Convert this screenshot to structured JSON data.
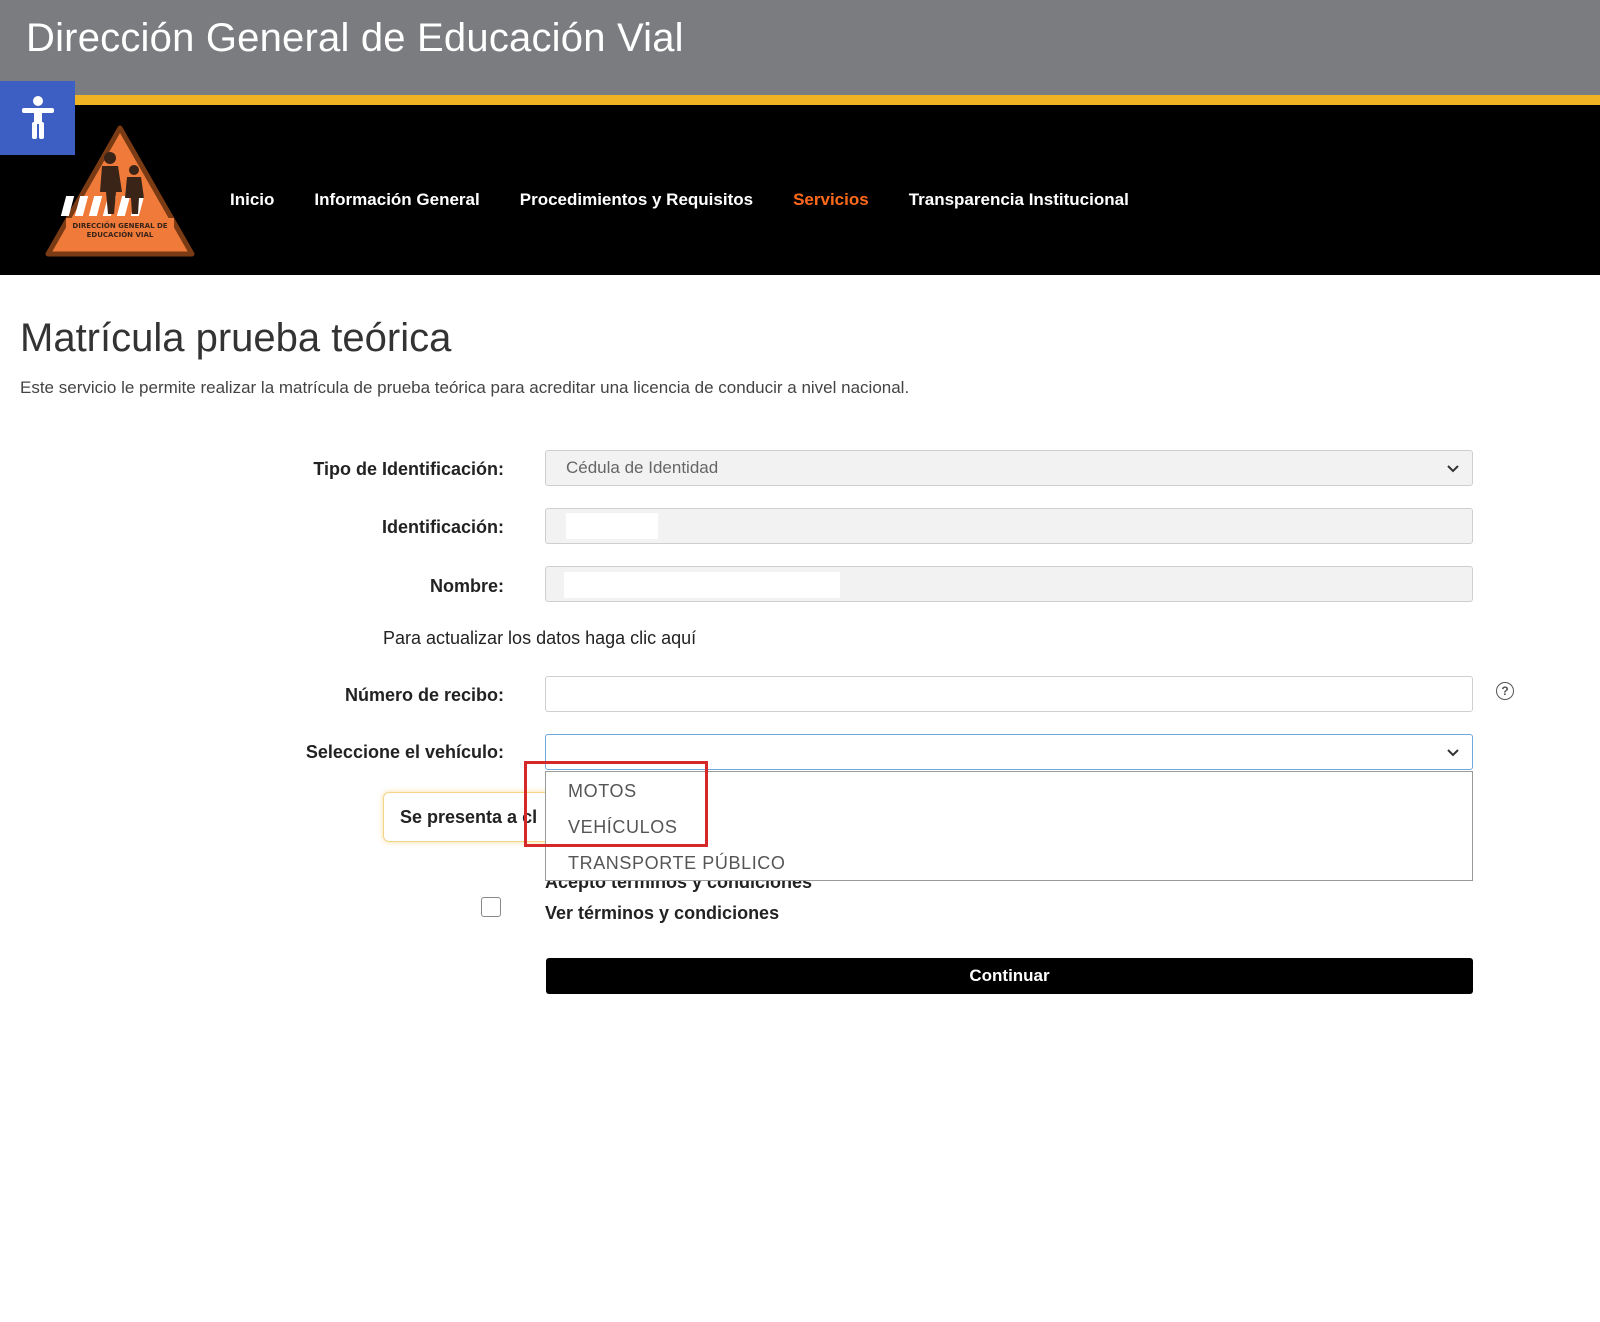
{
  "header": {
    "site_title": "Dirección General de Educación Vial",
    "logo_text": "DIRECCIÓN GENERAL DE EDUCACIÓN VIAL"
  },
  "nav": {
    "items": [
      {
        "label": "Inicio"
      },
      {
        "label": "Información General"
      },
      {
        "label": "Procedimientos y Requisitos"
      },
      {
        "label": "Servicios",
        "active": true
      },
      {
        "label": "Transparencia Institucional"
      }
    ]
  },
  "page": {
    "title": "Matrícula prueba teórica",
    "description": "Este servicio le permite realizar la matrícula de prueba teórica para acreditar una licencia de conducir a nivel nacional."
  },
  "form": {
    "id_type_label": "Tipo de Identificación:",
    "id_type_value": "Cédula de Identidad",
    "id_label": "Identificación:",
    "id_value": "",
    "name_label": "Nombre:",
    "name_value": "",
    "update_link": "Para actualizar los datos haga clic aquí",
    "receipt_label": "Número de recibo:",
    "receipt_value": "",
    "vehicle_label": "Seleccione el vehículo:",
    "vehicle_value": "",
    "vehicle_options": [
      "MOTOS",
      "VEHÍCULOS",
      "TRANSPORTE PÚBLICO"
    ],
    "present_text": "Se presenta a cl",
    "terms_accept": "Acepto términos y condiciones",
    "terms_link": "Ver términos y condiciones",
    "continue_label": "Continuar"
  },
  "colors": {
    "top_bar": "#7b7c80",
    "accent_yellow": "#f0b323",
    "nav_bg": "#000000",
    "nav_active": "#ff6a1a",
    "accessibility": "#3d5fc4",
    "highlight": "#d62828"
  }
}
